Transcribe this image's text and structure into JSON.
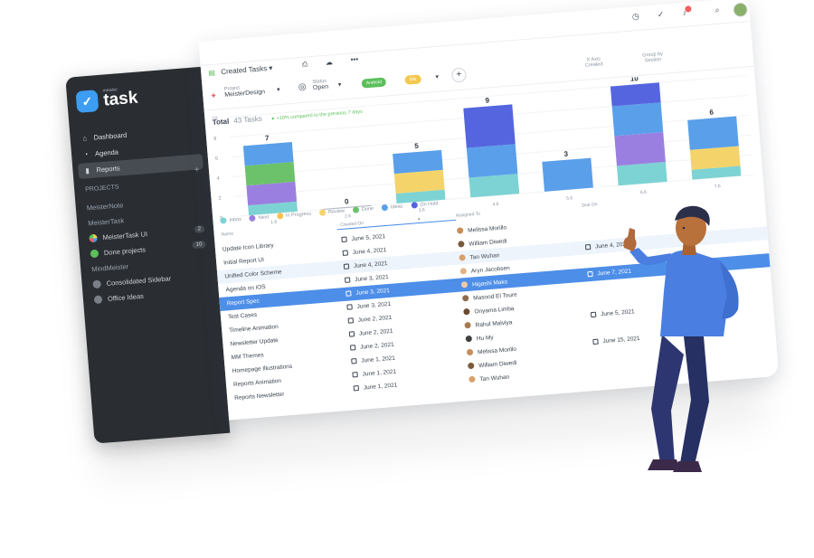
{
  "colors": {
    "sidebar_bg": "#2a2e33",
    "accent": "#3d9df2",
    "selected_row": "#4d8ee8",
    "positive": "#5cbf5c"
  },
  "sidebar": {
    "logo_small": "meister",
    "logo_text": "task",
    "nav": [
      {
        "label": "Dashboard",
        "icon": "home-icon"
      },
      {
        "label": "Agenda",
        "icon": "agenda-icon"
      },
      {
        "label": "Reports",
        "icon": "bar-chart-icon",
        "active": true
      }
    ],
    "projects_title": "PROJECTS",
    "groups": [
      {
        "label": "MeisterNote"
      },
      {
        "label": "MeisterTask"
      }
    ],
    "projects": [
      {
        "label": "MeisterTask UI",
        "count": "2",
        "color": "#f2c94c"
      },
      {
        "label": "Done projects",
        "count": "10",
        "color": "#5cbf5c"
      }
    ],
    "group_mind": "MindMeister",
    "more": [
      {
        "label": "Consolidated Sidebar",
        "color": "#7b8088"
      },
      {
        "label": "Office Ideas",
        "color": "#7b8088"
      }
    ]
  },
  "toolbar": {
    "view_label": "Created Tasks",
    "more_label": "•••"
  },
  "filters": {
    "project_label": "Project",
    "project_value": "MeisterDesign",
    "status_label": "Status",
    "status_value": "Open",
    "chips": [
      {
        "label": "Android",
        "color": "#5cbf5c"
      },
      {
        "label": "MN",
        "color": "#f2c94c"
      }
    ],
    "xaxis_label": "X Axis",
    "xaxis_value": "Created",
    "group_label": "Group by",
    "group_value": "Section"
  },
  "summary": {
    "total_label": "Total",
    "total_value": "43 Tasks",
    "trend": "+10% compared to the previous 7 days"
  },
  "chart_data": {
    "type": "bar",
    "stacked": true,
    "y_ticks": [
      "0",
      "2",
      "4",
      "6",
      "8",
      "10"
    ],
    "ylim": [
      0,
      10
    ],
    "categories": [
      "1.6",
      "2.6",
      "3.6",
      "4.6",
      "5.6",
      "6.6",
      "7.6"
    ],
    "totals": [
      7,
      0,
      5,
      9,
      3,
      10,
      6
    ],
    "series": [
      {
        "name": "Inbox",
        "color": "#7dd3d3",
        "values": [
          1,
          0,
          1,
          2,
          0,
          2,
          1
        ]
      },
      {
        "name": "Next",
        "color": "#9b7fe0",
        "values": [
          2,
          0,
          0,
          0,
          0,
          3,
          0
        ]
      },
      {
        "name": "In Progress",
        "color": "#f6c54b",
        "values": [
          0,
          0,
          0,
          0,
          0,
          0,
          0
        ]
      },
      {
        "name": "Review",
        "color": "#f4d46a",
        "values": [
          0,
          0,
          2,
          0,
          0,
          0,
          2
        ]
      },
      {
        "name": "Done",
        "color": "#6cc26a",
        "values": [
          2,
          0,
          0,
          0,
          0,
          0,
          0
        ]
      },
      {
        "name": "Ideas",
        "color": "#5a9fea",
        "values": [
          2,
          0,
          2,
          3,
          3,
          3,
          3
        ]
      },
      {
        "name": "On Hold",
        "color": "#5565e0",
        "values": [
          0,
          0,
          0,
          4,
          0,
          2,
          0
        ]
      }
    ]
  },
  "table": {
    "headers": [
      "Name",
      "Created On",
      "Assigned To",
      "Due On"
    ],
    "rows": [
      {
        "name": "Update Icon Library",
        "created": "June 5, 2021",
        "assigned": "Melissa Morillo",
        "due": "",
        "av": "#c98d5a"
      },
      {
        "name": "Initial Report UI",
        "created": "June 4, 2021",
        "assigned": "William Diwedi",
        "due": "",
        "av": "#7a5a3a"
      },
      {
        "name": "Unified Color Scheme",
        "created": "June 4, 2021",
        "assigned": "Tan Wuhan",
        "due": "June 4, 2021",
        "av": "#d9a16c",
        "hl": true
      },
      {
        "name": "Agenda on iOS",
        "created": "June 3, 2021",
        "assigned": "Aryn Jacobsen",
        "due": "",
        "av": "#e3b483"
      },
      {
        "name": "Report Spec",
        "created": "June 3, 2021",
        "assigned": "Higashi Mako",
        "due": "June 7, 2021",
        "av": "#f3c9a8",
        "sel": true
      },
      {
        "name": "Test Cases",
        "created": "June 3, 2021",
        "assigned": "Masood El Toure",
        "due": "",
        "av": "#8f6a4a"
      },
      {
        "name": "Timeline Animation",
        "created": "June 2, 2021",
        "assigned": "Onyama Limba",
        "due": "",
        "av": "#6b4a2f"
      },
      {
        "name": "Newsletter Update",
        "created": "June 2, 2021",
        "assigned": "Rahul Malviya",
        "due": "June 5, 2021",
        "av": "#a8794f"
      },
      {
        "name": "MM Themes",
        "created": "June 2, 2021",
        "assigned": "Hu My",
        "due": "",
        "av": "#3f3f3f"
      },
      {
        "name": "Homepage Illustrations",
        "created": "June 1, 2021",
        "assigned": "Melissa Morillo",
        "due": "June 15, 2021",
        "av": "#c98d5a"
      },
      {
        "name": "Reports Animation",
        "created": "June 1, 2021",
        "assigned": "William Diwedi",
        "due": "",
        "av": "#7a5a3a"
      },
      {
        "name": "Reports Newsletter",
        "created": "June 1, 2021",
        "assigned": "Tan Wuhan",
        "due": "",
        "av": "#d9a16c"
      }
    ]
  }
}
